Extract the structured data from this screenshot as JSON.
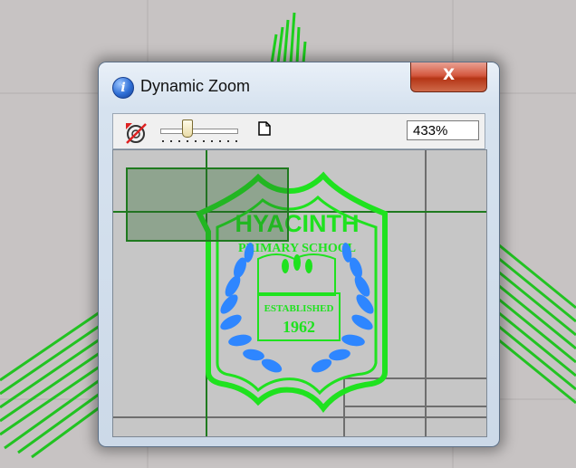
{
  "window": {
    "title": "Dynamic Zoom",
    "close_label": "X",
    "zoom_value": "433%"
  },
  "badge": {
    "line1": "HYACINTH",
    "line2": "PRIMARY SCHOOL",
    "line3": "ESTABLISHED",
    "line4": "1962"
  },
  "colors": {
    "embroidery_green": "#1fe21f",
    "laurel_blue": "#2e86ff",
    "canvas_gray": "#c6c6c6",
    "view_rect": "#1f7a1f"
  },
  "icons": {
    "title": "info-icon",
    "close": "close-icon",
    "zoom_tool": "zoom-tool-icon",
    "page": "page-icon"
  },
  "slider": {
    "level": 0.3
  }
}
